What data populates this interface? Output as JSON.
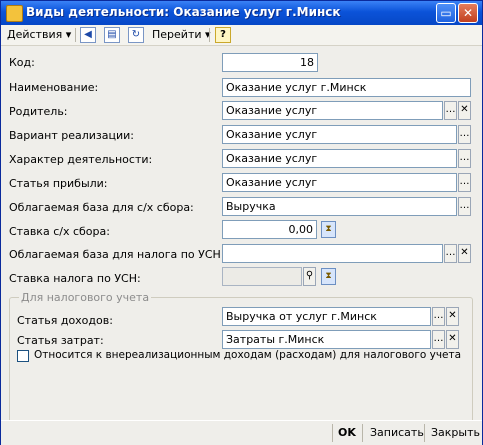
{
  "window": {
    "title": "Виды деятельности: Оказание услуг г.Минск"
  },
  "toolbar": {
    "actions_label": "Действия",
    "goto_label": "Перейти",
    "help_label": "?"
  },
  "form": {
    "code_label": "Код:",
    "code_value": "18",
    "name_label": "Наименование:",
    "name_value": "Оказание услуг г.Минск",
    "parent_label": "Родитель:",
    "parent_value": "Оказание услуг",
    "realization_label": "Вариант реализации:",
    "realization_value": "Оказание услуг",
    "activity_label": "Характер деятельности:",
    "activity_value": "Оказание услуг",
    "profit_label": "Статья прибыли:",
    "profit_value": "Оказание услуг",
    "base_agri_label": "Облагаемая база для с/х сбора:",
    "base_agri_value": "Выручка",
    "rate_agri_label": "Ставка с/х сбора:",
    "rate_agri_value": "0,00",
    "base_usn_label": "Облагаемая база для налога по УСН:",
    "base_usn_value": "",
    "rate_usn_label": "Ставка налога по УСН:",
    "rate_usn_value": ""
  },
  "tax": {
    "group_title": "Для налогового учета",
    "income_label": "Статья доходов:",
    "income_value": "Выручка от услуг г.Минск",
    "expense_label": "Статья затрат:",
    "expense_value": "Затраты г.Минск",
    "nonop_label": "Относится к внереализационным доходам (расходам) для налогового учета",
    "nonop_checked": false
  },
  "footer": {
    "ok_label": "OK",
    "save_label": "Записать",
    "close_label": "Закрыть"
  }
}
